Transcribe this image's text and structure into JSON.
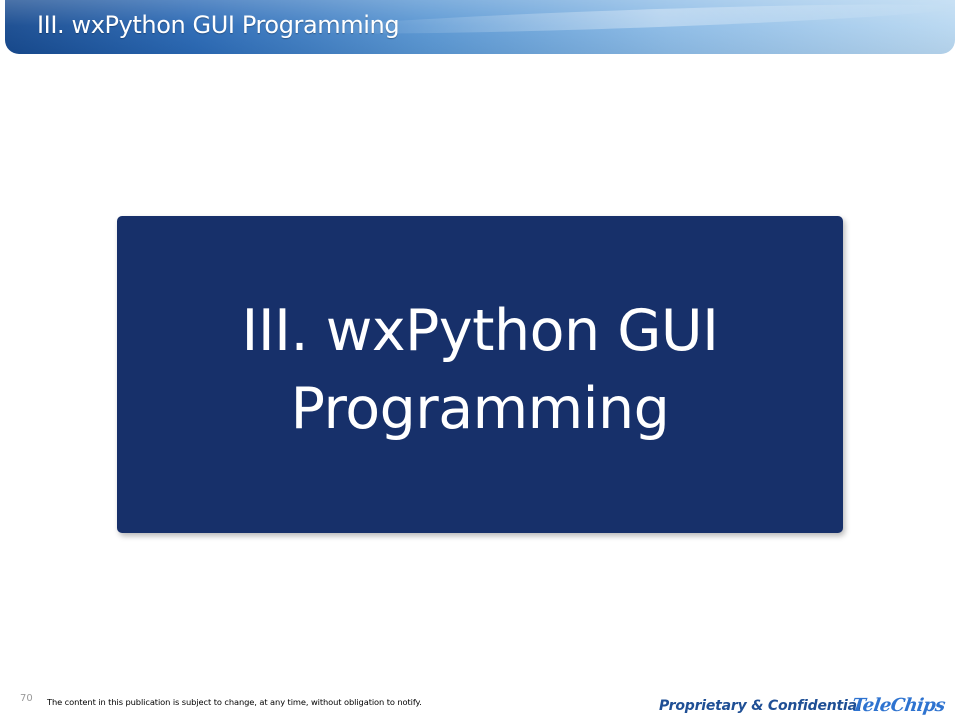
{
  "header": {
    "title": "III. wxPython GUI Programming"
  },
  "main": {
    "title_box_text": "III. wxPython GUI\nProgramming"
  },
  "footer": {
    "page_number": "70",
    "disclaimer": "The content in this publication is subject to change, at any time, without obligation to notify.",
    "confidential_label": "Proprietary & Confidential",
    "logo_text": "TeleChips"
  },
  "colors": {
    "header_blue": "#2a69b5",
    "title_box": "#17306a",
    "confidential_text": "#1f4f95",
    "logo_blue": "#2e73d0"
  }
}
